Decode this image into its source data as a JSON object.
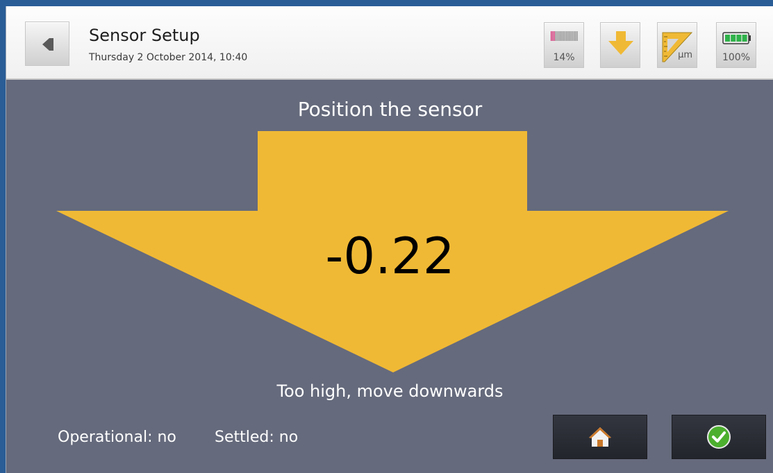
{
  "header": {
    "title": "Sensor Setup",
    "datetime": "Thursday 2 October 2014, 10:40",
    "back_icon": "back-arrow-icon"
  },
  "toolbar": {
    "signal": {
      "label": "14%",
      "icon": "signal-strength-icon",
      "value_percent": 14
    },
    "direction": {
      "icon": "down-arrow-icon"
    },
    "units": {
      "label": "µm",
      "icon": "ruler-icon"
    },
    "battery": {
      "label": "100%",
      "icon": "battery-icon",
      "value_percent": 100
    }
  },
  "main": {
    "instruction": "Position the sensor",
    "reading": "-0.22",
    "hint": "Too high, move downwards",
    "arrow_color": "#f0b935"
  },
  "status": {
    "operational": "Operational: no",
    "settled": "Settled: no"
  },
  "footer": {
    "home_icon": "home-icon",
    "confirm_icon": "check-circle-icon"
  },
  "colors": {
    "background": "#656a7c",
    "accent": "#f0b935",
    "header": "#f4f4f4"
  }
}
